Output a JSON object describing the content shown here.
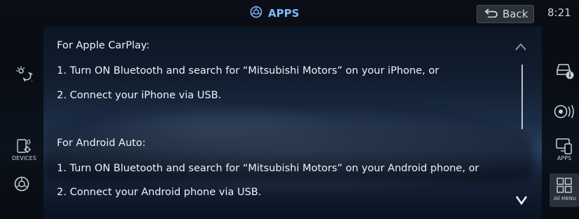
{
  "header": {
    "title": "APPS",
    "back_label": "Back",
    "time": "8:21"
  },
  "left_sidebar": {
    "devices_label": "DEVICES"
  },
  "right_sidebar": {
    "apps_label": "APPS",
    "all_menu_label": "All MENU"
  },
  "content": {
    "carplay_heading": "For Apple CarPlay:",
    "carplay_step1": "1. Turn ON Bluetooth and search for “Mitsubishi Motors” on your iPhone, or",
    "carplay_step2": "2. Connect your iPhone via USB.",
    "android_heading": "For Android Auto:",
    "android_step1": "1. Turn ON Bluetooth and search for “Mitsubishi Motors” on your Android phone, or",
    "android_step2": "2. Connect your Android phone via USB."
  },
  "colors": {
    "accent": "#7fb8ff",
    "bar_background": "#0a0e14"
  },
  "icons": [
    "apps-title-icon",
    "back-arrow-icon",
    "brightness-icon",
    "devices-icon",
    "settings-icon",
    "vehicle-info-icon",
    "audio-icon",
    "apps-icon",
    "all-menu-icon",
    "scroll-up-icon",
    "scroll-down-icon"
  ]
}
